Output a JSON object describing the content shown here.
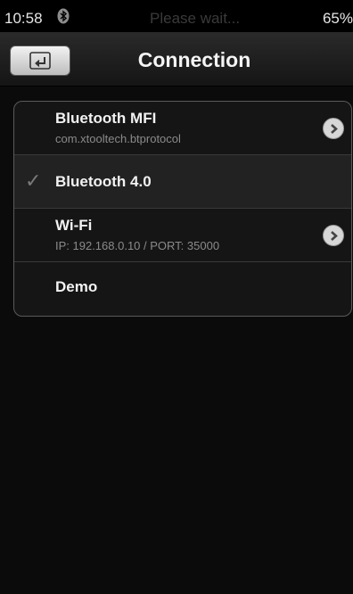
{
  "status_bar": {
    "time": "10:58",
    "wait_text": "Please wait...",
    "battery": "65%"
  },
  "nav": {
    "title": "Connection",
    "back_icon": "return-icon"
  },
  "connections": [
    {
      "title": "Bluetooth MFI",
      "subtitle": "com.xtooltech.btprotocol",
      "selected": false,
      "has_detail": true
    },
    {
      "title": "Bluetooth 4.0",
      "subtitle": "",
      "selected": true,
      "has_detail": false
    },
    {
      "title": "Wi-Fi",
      "subtitle": "IP: 192.168.0.10 / PORT: 35000",
      "selected": false,
      "has_detail": true
    },
    {
      "title": "Demo",
      "subtitle": "",
      "selected": false,
      "has_detail": false
    }
  ],
  "colors": {
    "background": "#0b0b0b",
    "list_border": "#5a5a5a",
    "selected_row": "#222222"
  }
}
